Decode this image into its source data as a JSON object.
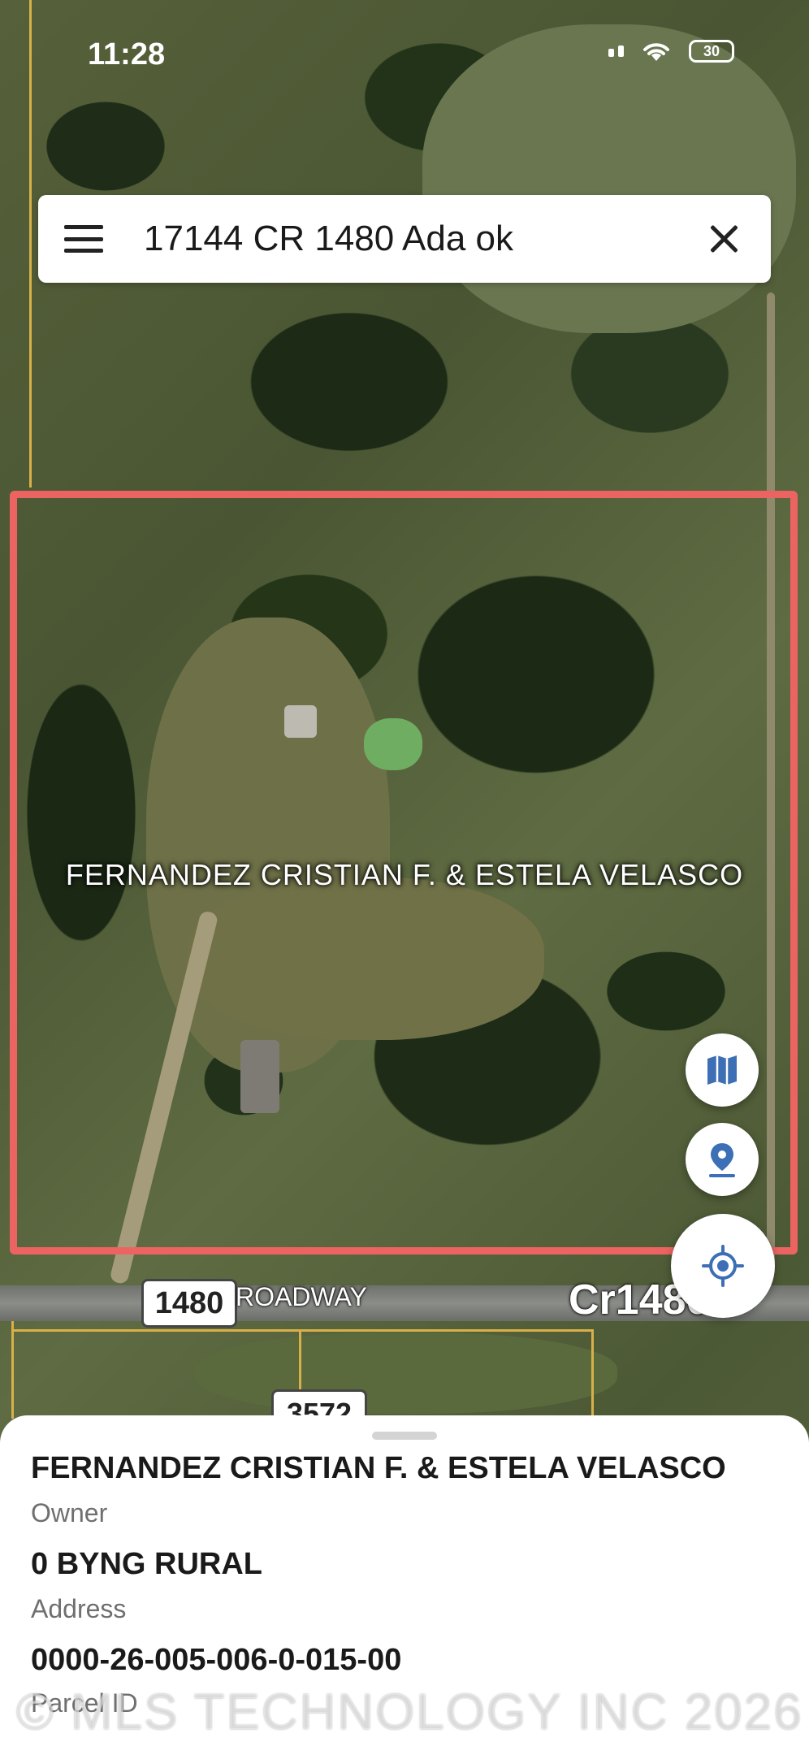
{
  "status_bar": {
    "time": "11:28",
    "battery": "30"
  },
  "search": {
    "query": "17144 CR 1480 Ada ok"
  },
  "map": {
    "parcel_label": "FERNANDEZ CRISTIAN F. & ESTELA VELASCO",
    "road_shield_1480": "1480",
    "road_name": "ROADWAY",
    "road_label_cr": "Cr1480",
    "road_shield_3572": "3572",
    "boundary_color": "#ec6461"
  },
  "fabs": {
    "map_layers_icon": "map-icon",
    "pin_icon": "location-pin-icon",
    "locate_icon": "crosshair-icon",
    "accent": "#3d6fb6"
  },
  "sheet": {
    "owner_value": "FERNANDEZ CRISTIAN F. & ESTELA VELASCO",
    "owner_label": "Owner",
    "address_value": "0 BYNG RURAL",
    "address_label": "Address",
    "parcel_value": "0000-26-005-006-0-015-00",
    "parcel_label": "Parcel ID"
  },
  "watermark": "© MLS TECHNOLOGY INC 2026"
}
